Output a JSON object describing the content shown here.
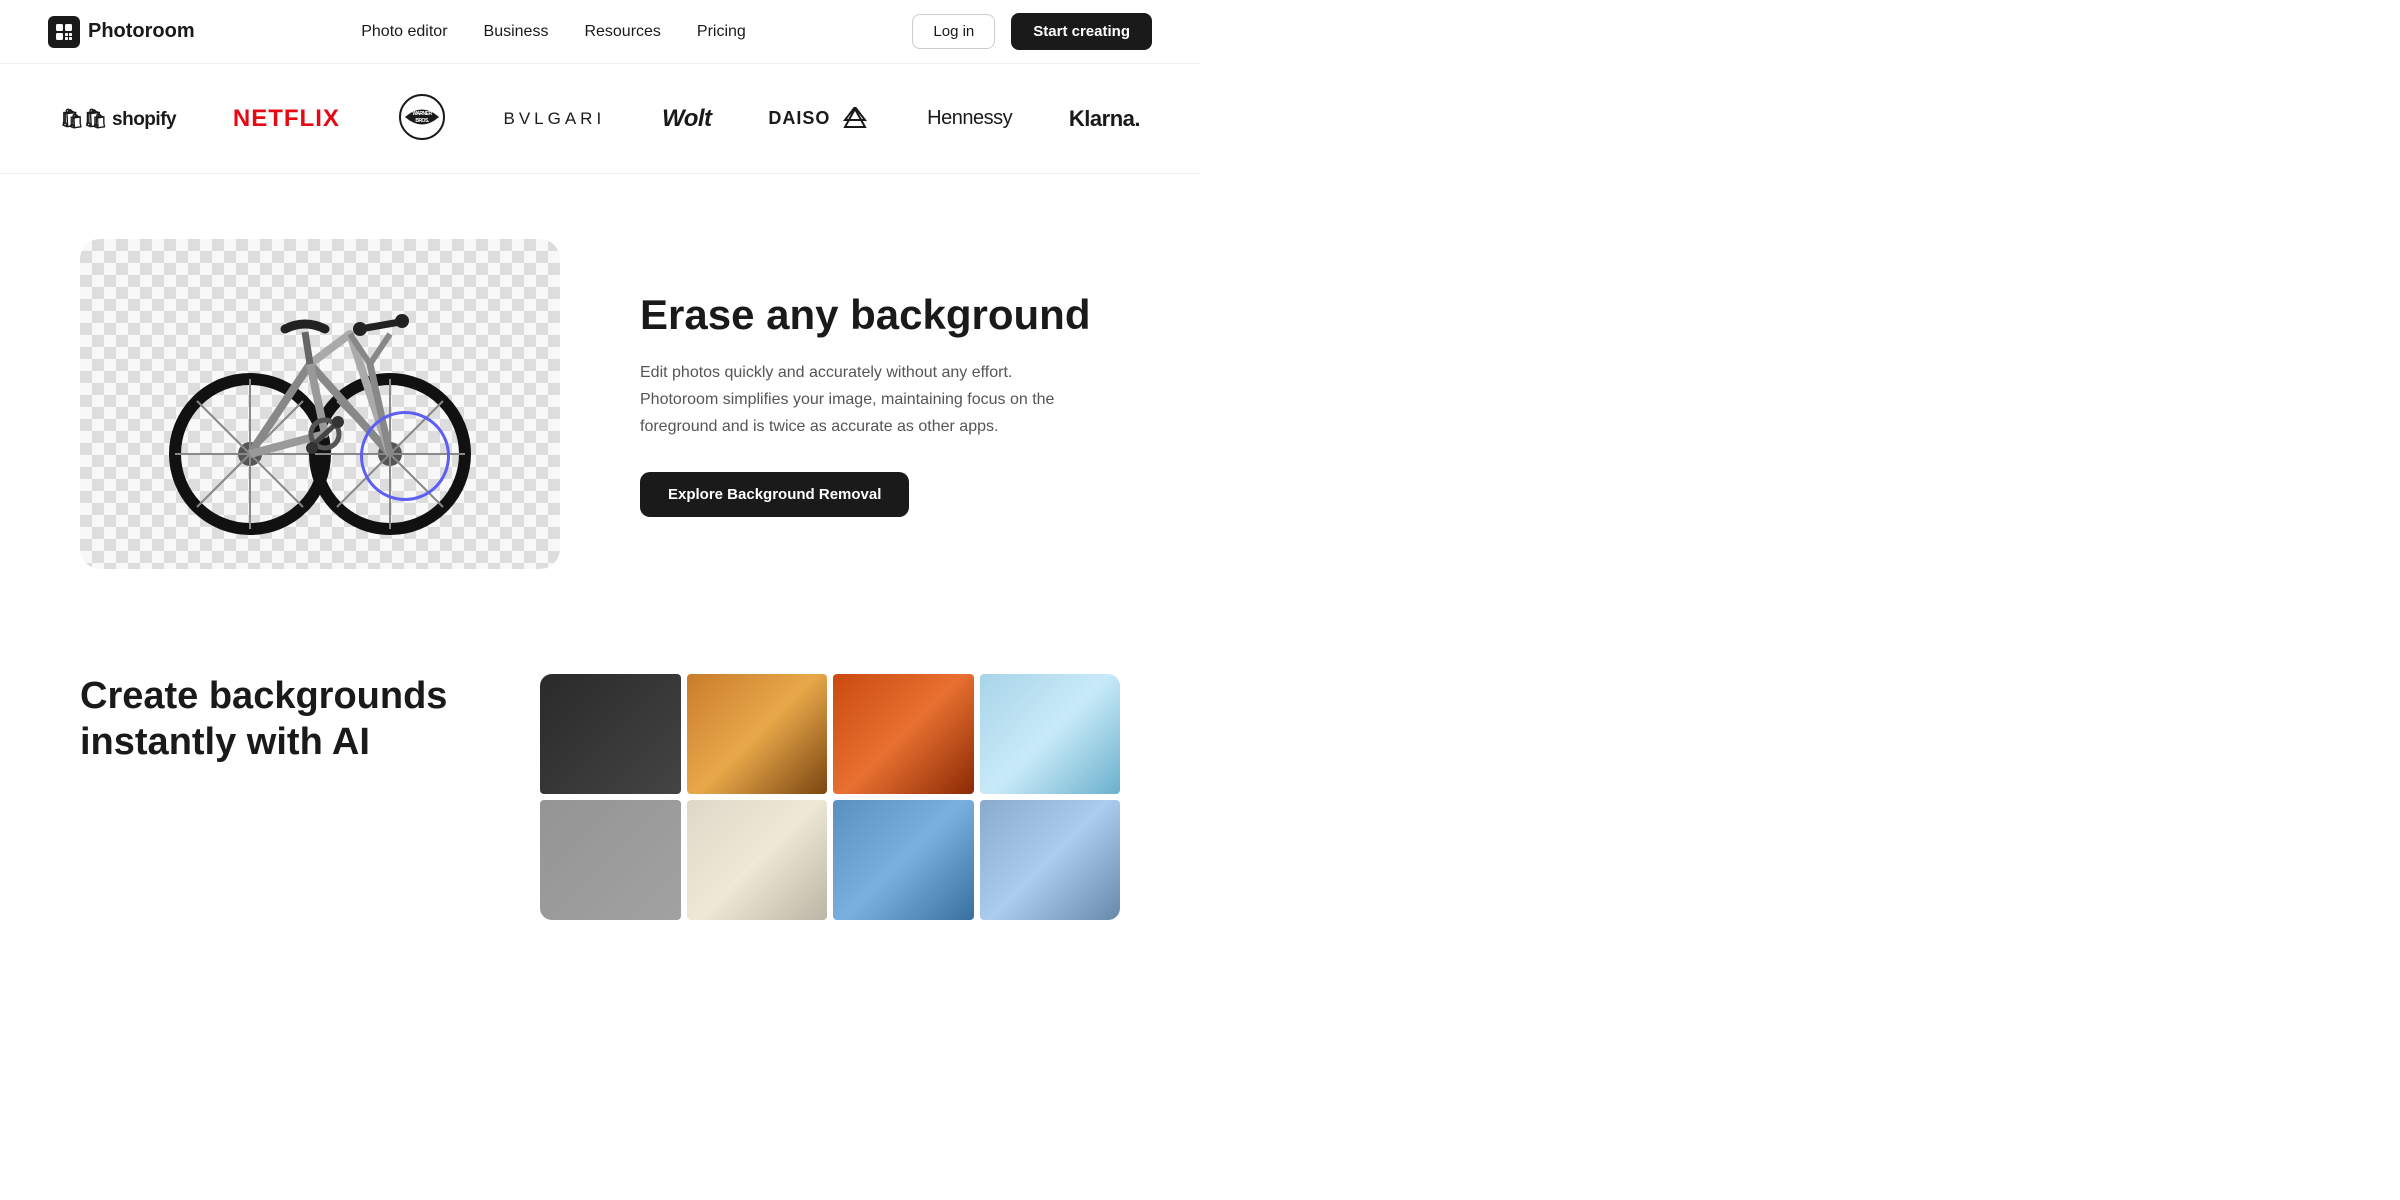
{
  "nav": {
    "logo_icon": "P",
    "logo_text": "Photoroom",
    "links": [
      {
        "id": "photo-editor",
        "label": "Photo editor"
      },
      {
        "id": "business",
        "label": "Business"
      },
      {
        "id": "resources",
        "label": "Resources"
      },
      {
        "id": "pricing",
        "label": "Pricing"
      }
    ],
    "login_label": "Log in",
    "start_label": "Start creating"
  },
  "logos": [
    {
      "id": "shopify",
      "text": "🛍 shopify",
      "class": "shopify"
    },
    {
      "id": "netflix",
      "text": "NETFLIX",
      "class": "netflix"
    },
    {
      "id": "warnerbros",
      "text": "WARNER\nBROS.",
      "class": "warnerbros"
    },
    {
      "id": "bvlgari",
      "text": "BVLGARI",
      "class": "bvlgari"
    },
    {
      "id": "wolt",
      "text": "Wolt",
      "class": "wolt"
    },
    {
      "id": "daiso",
      "text": "DAISO ✦✦",
      "class": "daiso"
    },
    {
      "id": "hennessy",
      "text": "Hennessy",
      "class": "hennessy"
    },
    {
      "id": "klarna",
      "text": "Klarna.",
      "class": "klarna"
    }
  ],
  "erase_section": {
    "title": "Erase any background",
    "description": "Edit photos quickly and accurately without any effort. Photoroom simplifies your image, maintaining focus on the foreground and is twice as accurate as other apps.",
    "cta_label": "Explore Background Removal"
  },
  "create_section": {
    "title": "Create backgrounds\ninstantly with AI"
  }
}
